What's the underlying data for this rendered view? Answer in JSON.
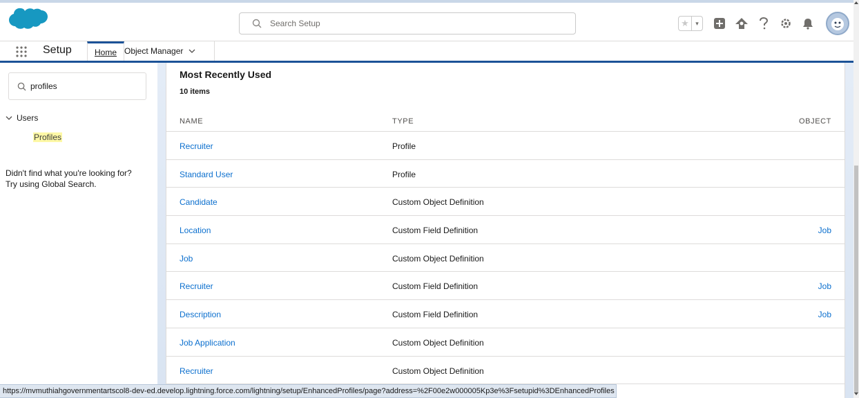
{
  "header": {
    "search_placeholder": "Search Setup",
    "favorites_star": "★",
    "favorites_dropdown": "▾",
    "icons": [
      "add-icon",
      "trailhead-icon",
      "help-icon",
      "setup-gear-icon",
      "notifications-bell-icon",
      "user-avatar-icon"
    ]
  },
  "nav": {
    "app_name": "Setup",
    "tabs": [
      {
        "label": "Home",
        "active": true
      },
      {
        "label": "Object Manager",
        "active": false
      }
    ]
  },
  "sidebar": {
    "quick_find_value": "profiles",
    "tree": {
      "section": "Users",
      "item": "Profiles"
    },
    "not_found_line1": "Didn't find what you're looking for?",
    "not_found_line2": "Try using Global Search."
  },
  "main": {
    "title": "Most Recently Used",
    "count": "10 items",
    "columns": [
      "NAME",
      "TYPE",
      "OBJECT"
    ],
    "rows": [
      {
        "name": "Recruiter",
        "type": "Profile",
        "object": ""
      },
      {
        "name": "Standard User",
        "type": "Profile",
        "object": ""
      },
      {
        "name": "Candidate",
        "type": "Custom Object Definition",
        "object": ""
      },
      {
        "name": "Location",
        "type": "Custom Field Definition",
        "object": "Job"
      },
      {
        "name": "Job",
        "type": "Custom Object Definition",
        "object": ""
      },
      {
        "name": "Recruiter",
        "type": "Custom Field Definition",
        "object": "Job"
      },
      {
        "name": "Description",
        "type": "Custom Field Definition",
        "object": "Job"
      },
      {
        "name": "Job Application",
        "type": "Custom Object Definition",
        "object": ""
      },
      {
        "name": "Recruiter",
        "type": "Custom Object Definition",
        "object": ""
      }
    ]
  },
  "status_url": "https://mvmuthiahgovernmentartscol8-dev-ed.develop.lightning.force.com/lightning/setup/EnhancedProfiles/page?address=%2F00e2w000005Kp3e%3Fsetupid%3DEnhancedProfiles",
  "colors": {
    "brand_blue": "#1b5297",
    "link_blue": "#0b6fce",
    "highlight_yellow": "#fdf8a6",
    "salesforce_cloud": "#1798c1"
  }
}
